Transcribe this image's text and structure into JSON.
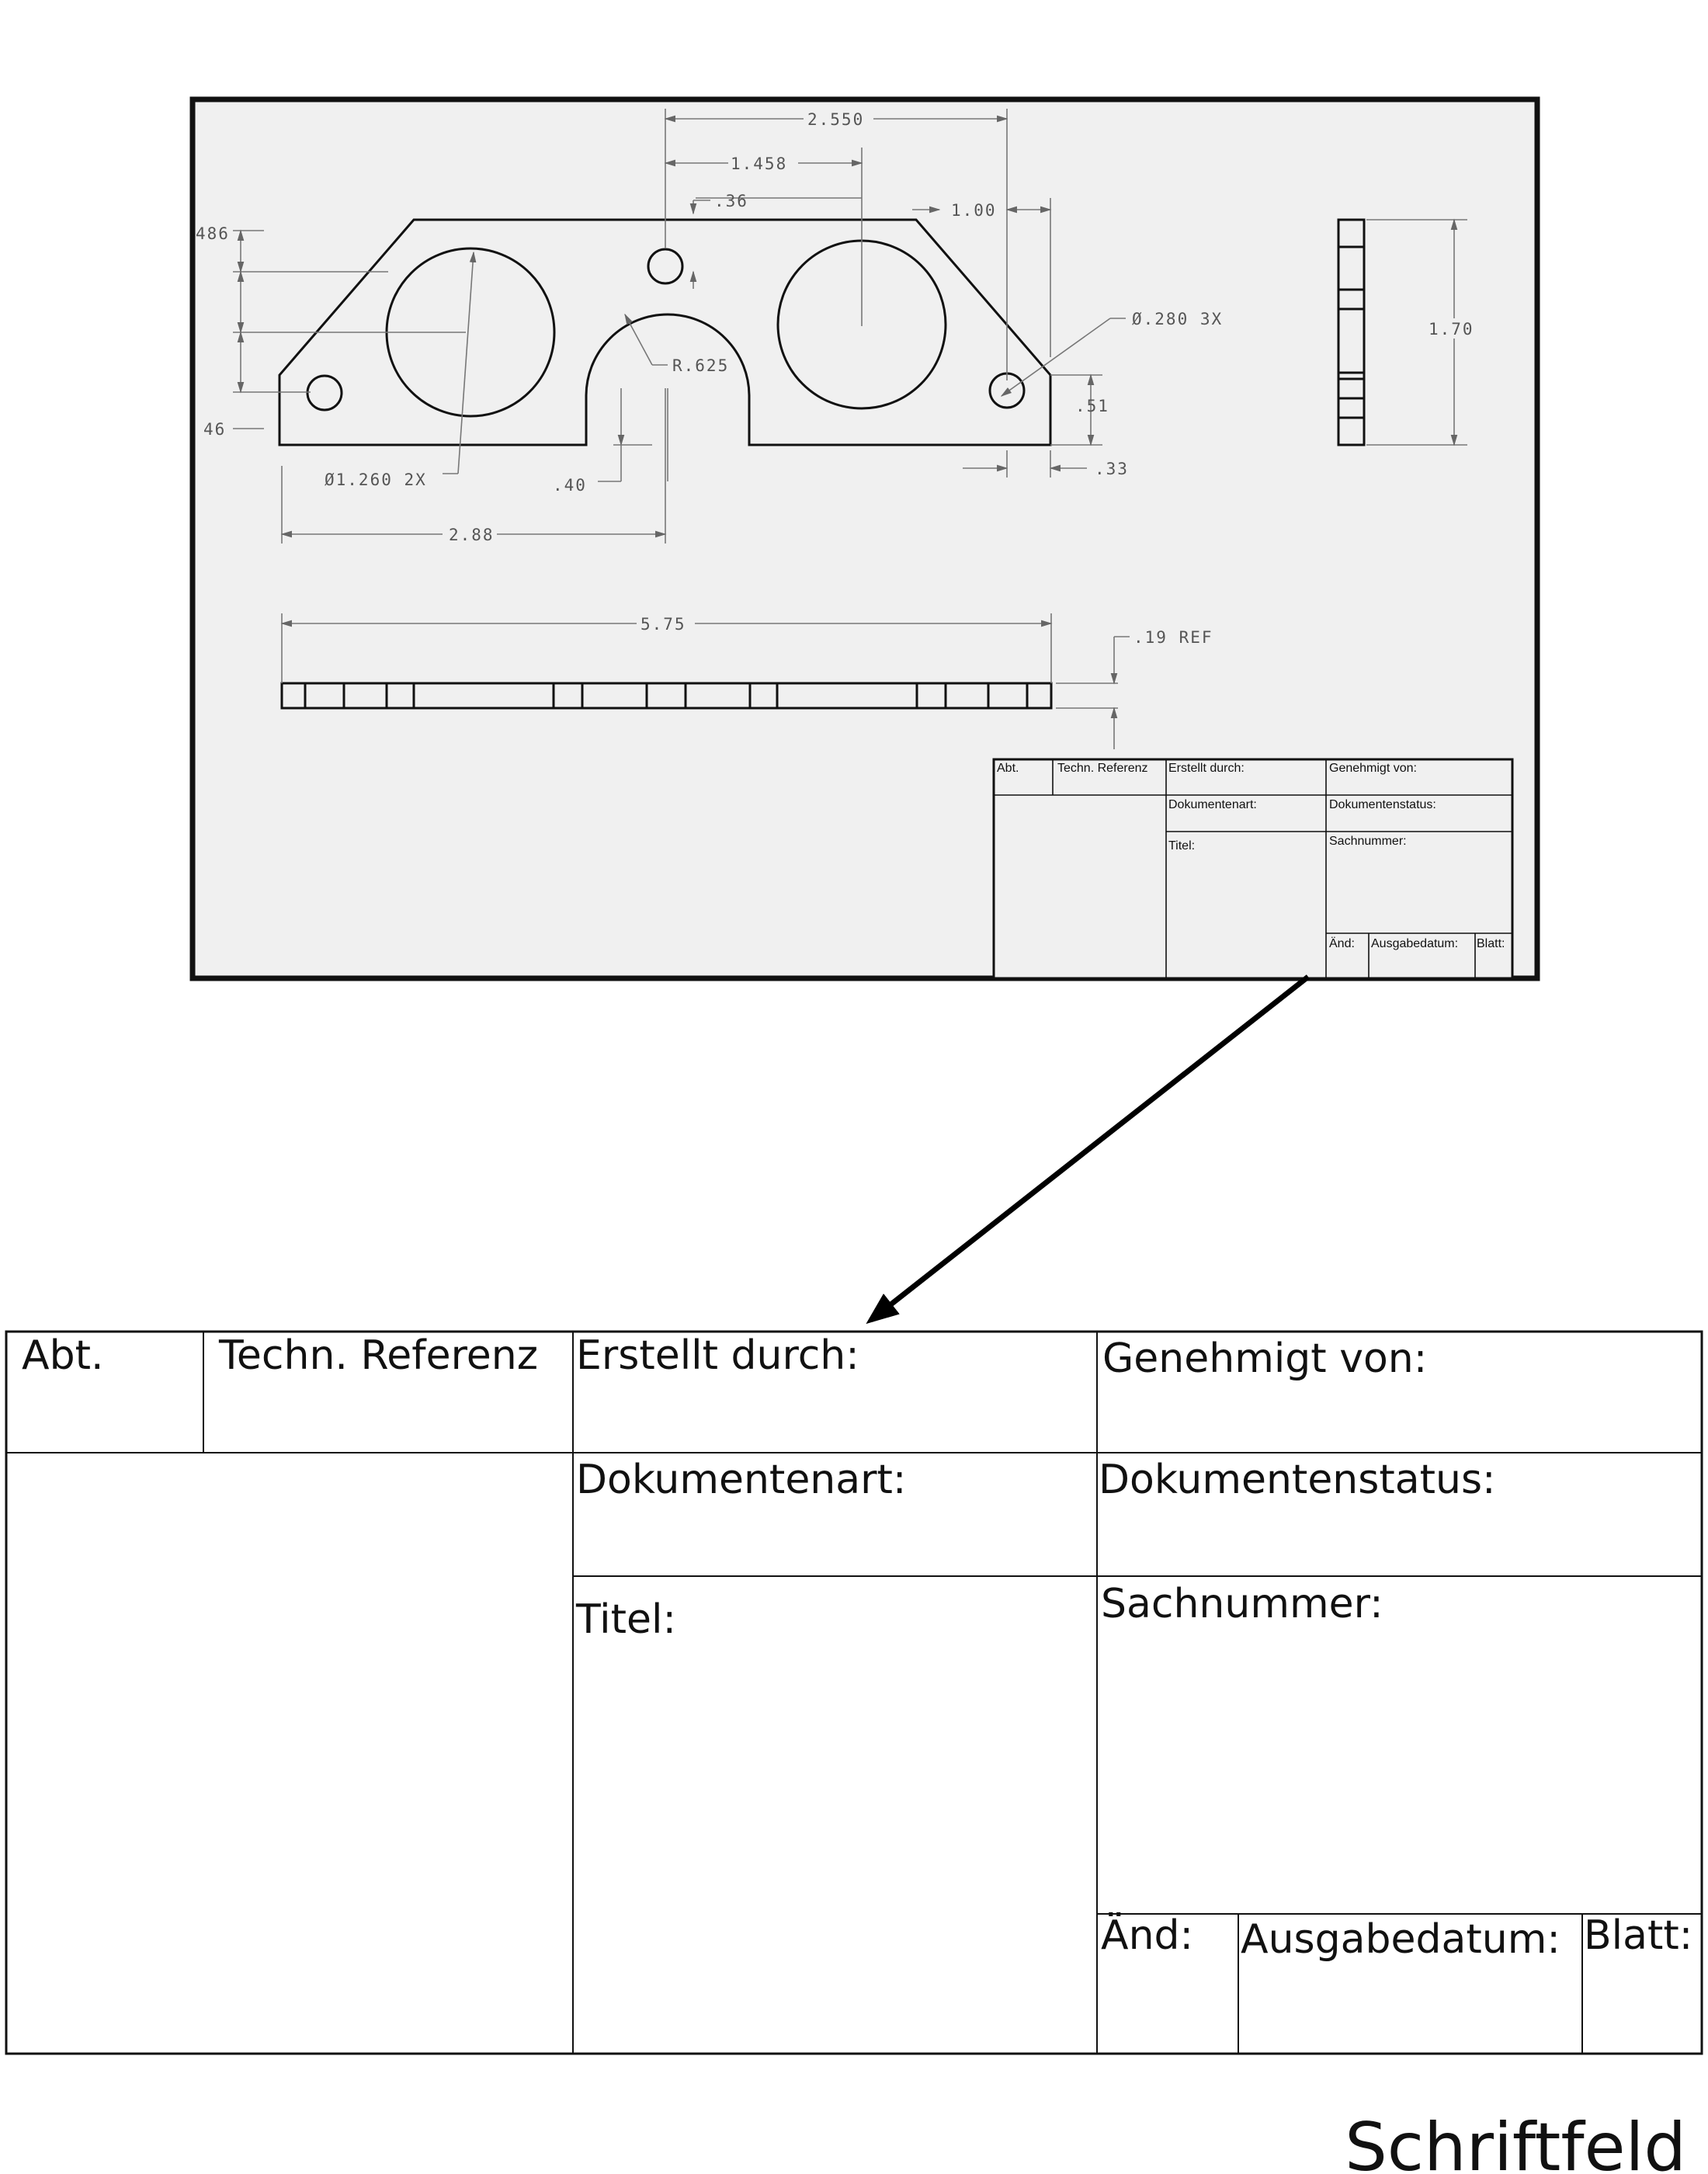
{
  "drawing": {
    "dimensions": {
      "d_2550": "2.550",
      "d_1458": "1.458",
      "d_036": ".36",
      "d_100": "1.00",
      "d_486": "486",
      "d_046": "46",
      "d_hole_dia": "Ø.280 3X",
      "d_r625": "R.625",
      "d_051": ".51",
      "d_033": ".33",
      "d_big_dia": "Ø1.260 2X",
      "d_040": ".40",
      "d_288": "2.88",
      "d_170": "1.70",
      "d_575": "5.75",
      "d_019": ".19 REF"
    }
  },
  "title_block": {
    "abt": "Abt.",
    "techn_referenz": "Techn. Referenz",
    "erstellt_durch": "Erstellt durch:",
    "genehmigt_von": "Genehmigt von:",
    "dokumentenart": "Dokumentenart:",
    "dokumentenstatus": "Dokumentenstatus:",
    "titel": "Titel:",
    "sachnummer": "Sachnummer:",
    "aend": "Änd:",
    "ausgabedatum": "Ausgabedatum:",
    "blatt": "Blatt:"
  },
  "caption": "Schriftfeld"
}
